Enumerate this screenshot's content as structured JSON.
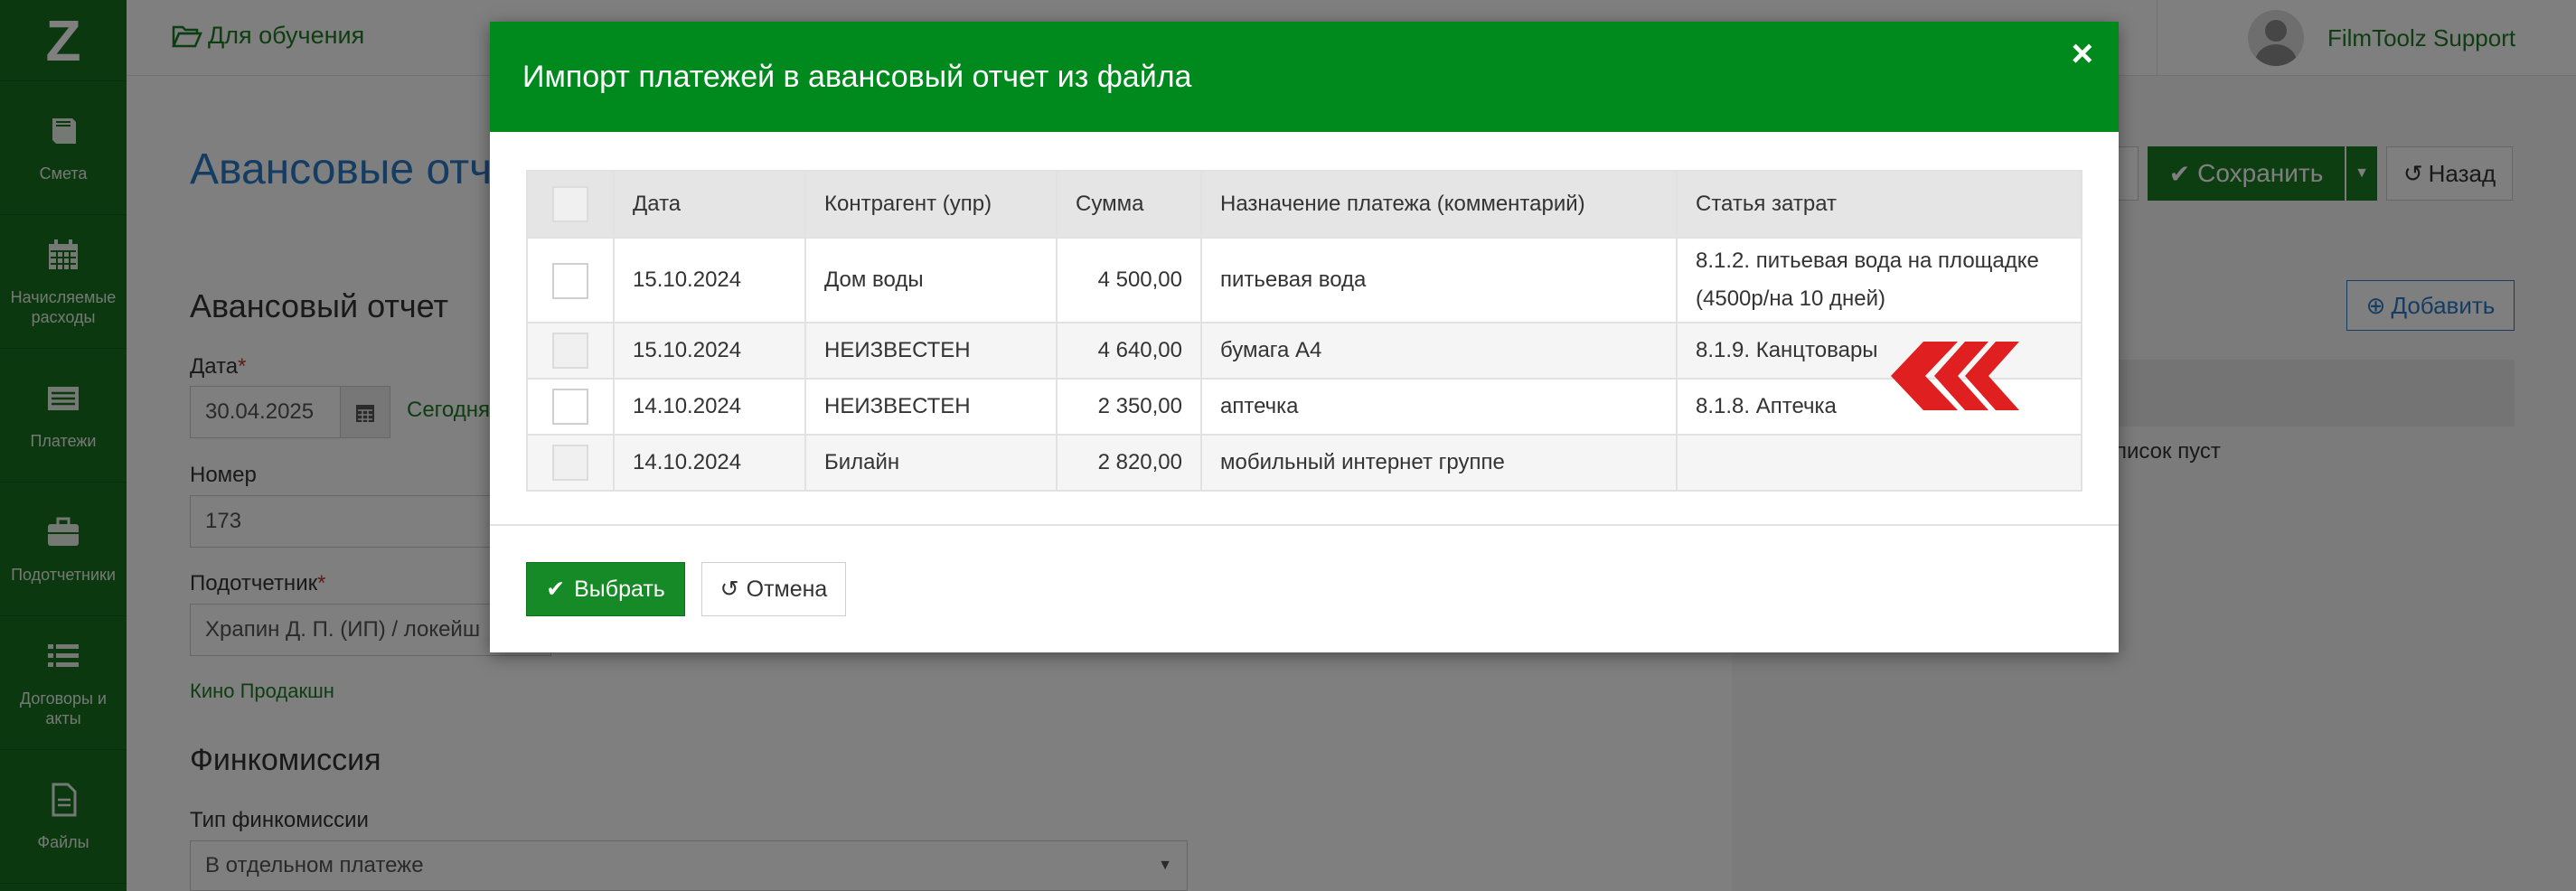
{
  "app": {
    "logo_glyph": "Z",
    "project": "Для обучения",
    "user_name": "FilmToolz Support",
    "language": "RU"
  },
  "sidebar": {
    "items": [
      {
        "label": "Смета",
        "icon": "book-icon"
      },
      {
        "label": "Начисляемые расходы",
        "icon": "calendar-icon"
      },
      {
        "label": "Платежи",
        "icon": "list-alt-icon"
      },
      {
        "label": "Подотчетники",
        "icon": "briefcase-icon"
      },
      {
        "label": "Договоры и акты",
        "icon": "list-icon"
      },
      {
        "label": "Файлы",
        "icon": "file-icon"
      }
    ]
  },
  "page": {
    "title": "Авансовые отч",
    "section": "Авансовый отчет",
    "date_label": "Дата",
    "date_value": "30.04.2025",
    "today_link": "Сегодня",
    "number_label": "Номер",
    "number_value": "173",
    "accountable_label": "Подотчетник",
    "accountable_value": "Храпин Д. П. (ИП) / локейш",
    "company_link": "Кино Продакшн",
    "fin_title": "Финкомиссия",
    "fin_type_label": "Тип финкомиссии",
    "fin_type_value": "В отдельном платеже",
    "save_label": "Сохранить",
    "back_label": "Назад",
    "add_label": "Добавить",
    "empty_list": "писок пуст"
  },
  "modal": {
    "title": "Импорт платежей в авансовый отчет из файла",
    "close_glyph": "×",
    "columns": [
      "Дата",
      "Контрагент (упр)",
      "Сумма",
      "Назначение платежа (комментарий)",
      "Статья затрат"
    ],
    "rows": [
      {
        "date": "15.10.2024",
        "counterparty": "Дом воды",
        "sum": "4 500,00",
        "purpose": "питьевая вода",
        "article": "8.1.2. питьевая вода на площадке (4500р/на 10 дней)",
        "selectable": true
      },
      {
        "date": "15.10.2024",
        "counterparty": "НЕИЗВЕСТЕН",
        "sum": "4 640,00",
        "purpose": "бумага А4",
        "article": "8.1.9. Канцтовары",
        "selectable": false
      },
      {
        "date": "14.10.2024",
        "counterparty": "НЕИЗВЕСТЕН",
        "sum": "2 350,00",
        "purpose": "аптечка",
        "article": "8.1.8. Аптечка",
        "selectable": true
      },
      {
        "date": "14.10.2024",
        "counterparty": "Билайн",
        "sum": "2 820,00",
        "purpose": "мобильный интернет группе",
        "article": "",
        "selectable": false
      }
    ],
    "select_label": "Выбрать",
    "cancel_label": "Отмена"
  },
  "colors": {
    "sidebar": "#17701f",
    "modal_header": "#008a1e",
    "primary_button": "#168a26",
    "link": "#1c7a23",
    "arrow_marker": "#e02020"
  }
}
